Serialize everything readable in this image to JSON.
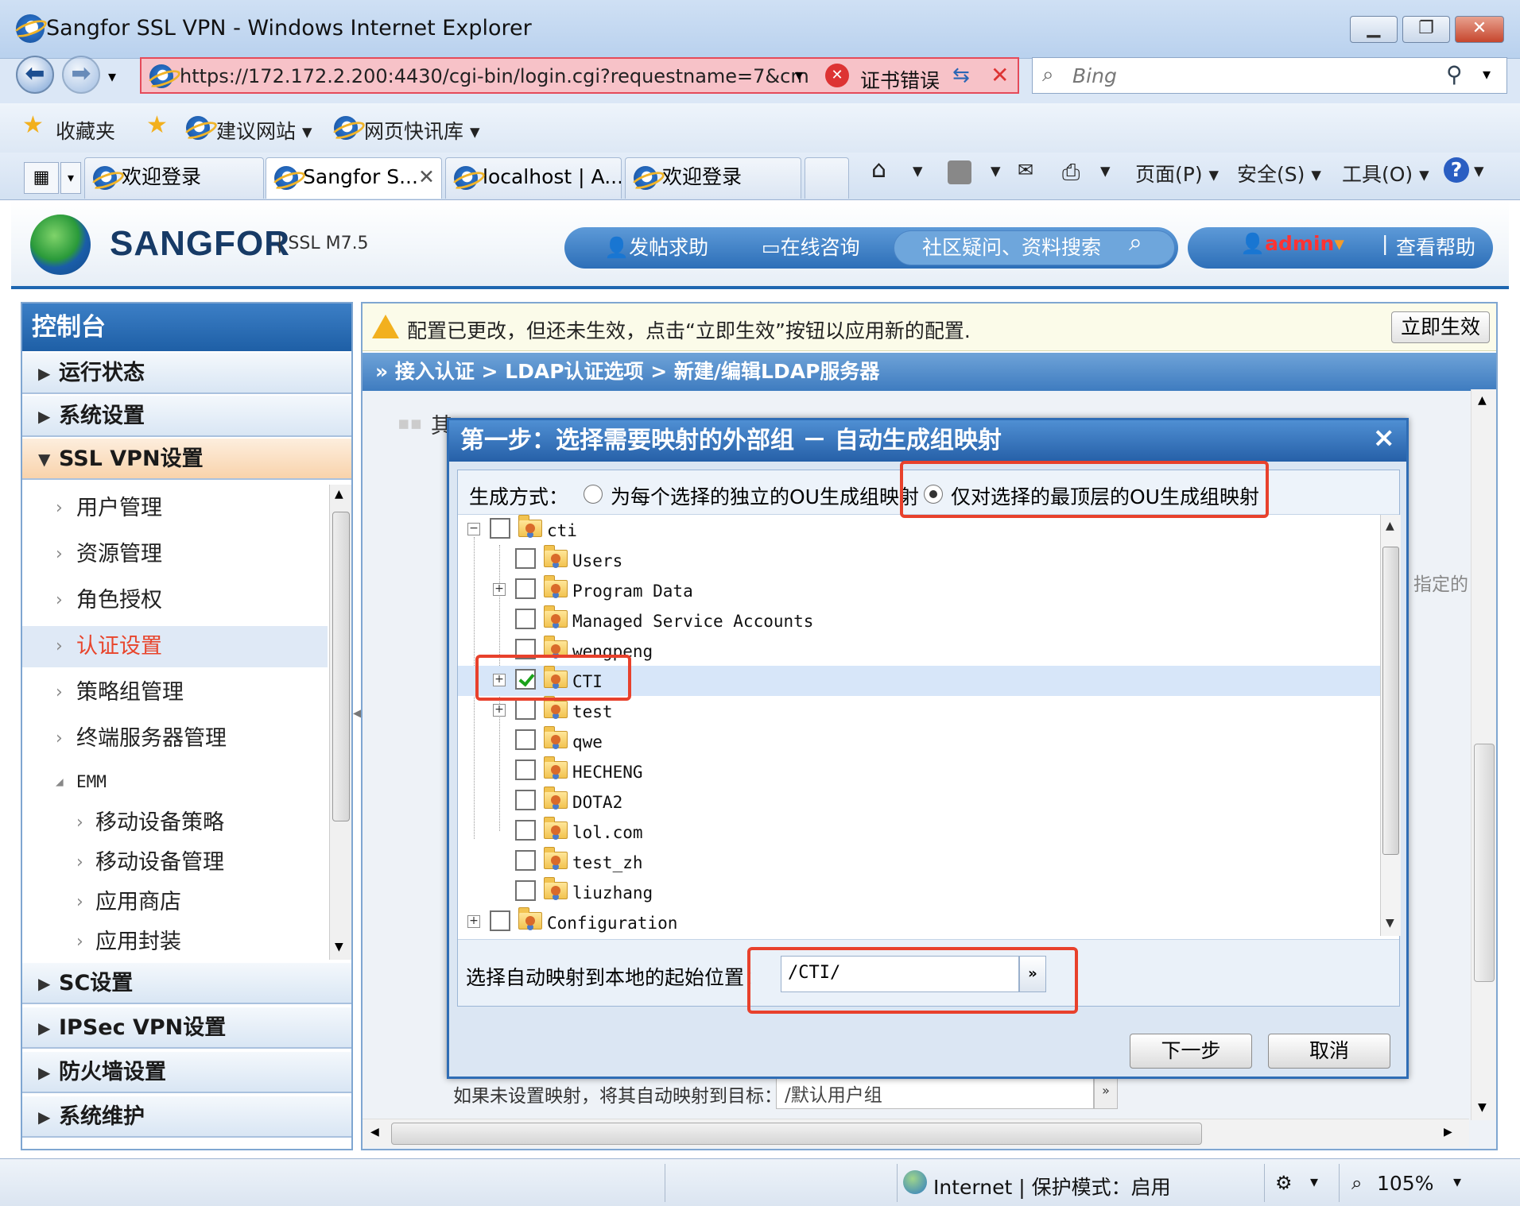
{
  "browser": {
    "window_title": "Sangfor SSL VPN - Windows Internet Explorer",
    "url": "https://172.172.2.200:4430/cgi-bin/login.cgi?requestname=7&cm",
    "cert_error": "证书错误",
    "search_placeholder": "Bing",
    "favorites": "收藏夹",
    "suggested_sites": "建议网站 ▾",
    "web_slice": "网页快讯库 ▾",
    "tabs": [
      {
        "label": "欢迎登录"
      },
      {
        "label": "Sangfor S..."
      },
      {
        "label": "localhost | A..."
      },
      {
        "label": "欢迎登录"
      }
    ],
    "commands": {
      "page": "页面(P) ▾",
      "safety": "安全(S) ▾",
      "tools": "工具(O) ▾"
    }
  },
  "header": {
    "brand": "SANGFOR",
    "version": "SSL M7.5",
    "post_help": "发帖求助",
    "online_consult": "在线咨询",
    "community_search": "社区疑问、资料搜索",
    "user": "admin",
    "view_help": "查看帮助"
  },
  "sidebar": {
    "title": "控制台",
    "sections": {
      "status": "运行状态",
      "system": "系统设置",
      "sslvpn": "SSL VPN设置",
      "sc": "SC设置",
      "ipsec": "IPSec VPN设置",
      "firewall": "防火墙设置",
      "maintenance": "系统维护"
    },
    "items": {
      "user_mgmt": "用户管理",
      "resource_mgmt": "资源管理",
      "role_auth": "角色授权",
      "auth_settings": "认证设置",
      "policy_group": "策略组管理",
      "terminal_server": "终端服务器管理",
      "emm": "EMM",
      "mobile_policy": "移动设备策略",
      "mobile_mgmt": "移动设备管理",
      "app_store": "应用商店",
      "app_wrap": "应用封装"
    }
  },
  "main": {
    "notice": "配置已更改，但还未生效，点击“立即生效”按钮以应用新的配置.",
    "apply_button": "立即生效",
    "breadcrumb": "» 接入认证  >  LDAP认证选项  >  新建/编辑LDAP服务器",
    "bg_heading_char": "其",
    "bg_specified": "指定的",
    "unmapped_label": "如果未设置映射，将其自动映射到目标：",
    "unmapped_value": "/默认用户组"
  },
  "dialog": {
    "title": "第一步：选择需要映射的外部组 － 自动生成组映射",
    "mode_label": "生成方式：",
    "mode_option1": "为每个选择的独立的OU生成组映射",
    "mode_option2": "仅对选择的最顶层的OU生成组映射",
    "selected_mode": "option2",
    "tree": {
      "root": {
        "label": "cti",
        "checked": false
      },
      "children": [
        {
          "label": "Users",
          "checked": false
        },
        {
          "label": "Program Data",
          "checked": false
        },
        {
          "label": "Managed Service Accounts",
          "checked": false
        },
        {
          "label": "wengpeng",
          "checked": false
        },
        {
          "label": "CTI",
          "checked": true
        },
        {
          "label": "test",
          "checked": false
        },
        {
          "label": "qwe",
          "checked": false
        },
        {
          "label": "HECHENG",
          "checked": false
        },
        {
          "label": "DOTA2",
          "checked": false
        },
        {
          "label": "lol.com",
          "checked": false
        },
        {
          "label": "test_zh",
          "checked": false
        },
        {
          "label": "liuzhang",
          "checked": false
        }
      ],
      "sibling": {
        "label": "Configuration",
        "checked": false
      }
    },
    "start_label": "选择自动映射到本地的起始位置：",
    "start_value": "/CTI/",
    "next_button": "下一步",
    "cancel_button": "取消"
  },
  "status_bar": {
    "zone": "Internet | 保护模式：启用",
    "zoom": "105%"
  },
  "colors": {
    "highlight_box": "#e8412c",
    "selected_nav": "#e8452c",
    "header_blue": "#1e66b0"
  }
}
